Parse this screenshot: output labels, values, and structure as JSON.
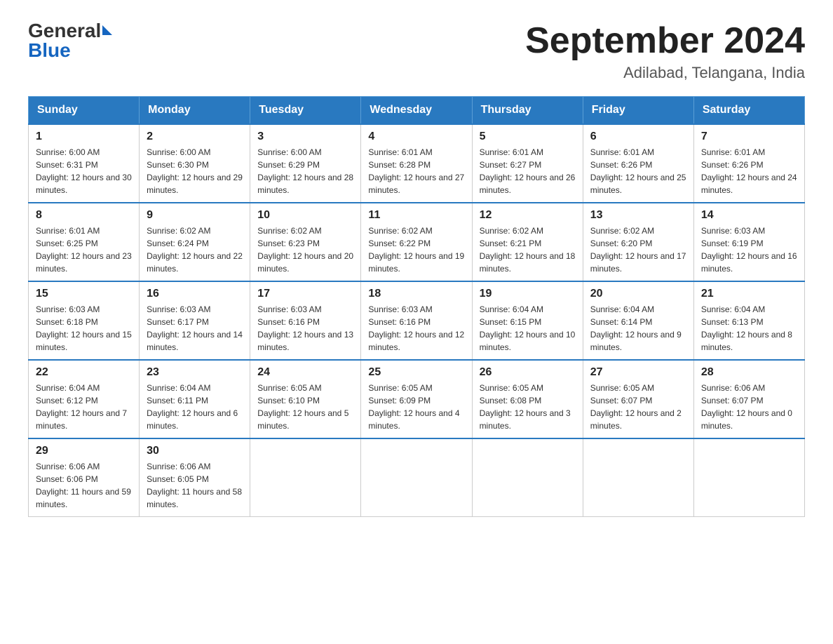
{
  "header": {
    "logo_general": "General",
    "logo_blue": "Blue",
    "title": "September 2024",
    "subtitle": "Adilabad, Telangana, India"
  },
  "days_of_week": [
    "Sunday",
    "Monday",
    "Tuesday",
    "Wednesday",
    "Thursday",
    "Friday",
    "Saturday"
  ],
  "weeks": [
    [
      {
        "date": "1",
        "sunrise": "Sunrise: 6:00 AM",
        "sunset": "Sunset: 6:31 PM",
        "daylight": "Daylight: 12 hours and 30 minutes."
      },
      {
        "date": "2",
        "sunrise": "Sunrise: 6:00 AM",
        "sunset": "Sunset: 6:30 PM",
        "daylight": "Daylight: 12 hours and 29 minutes."
      },
      {
        "date": "3",
        "sunrise": "Sunrise: 6:00 AM",
        "sunset": "Sunset: 6:29 PM",
        "daylight": "Daylight: 12 hours and 28 minutes."
      },
      {
        "date": "4",
        "sunrise": "Sunrise: 6:01 AM",
        "sunset": "Sunset: 6:28 PM",
        "daylight": "Daylight: 12 hours and 27 minutes."
      },
      {
        "date": "5",
        "sunrise": "Sunrise: 6:01 AM",
        "sunset": "Sunset: 6:27 PM",
        "daylight": "Daylight: 12 hours and 26 minutes."
      },
      {
        "date": "6",
        "sunrise": "Sunrise: 6:01 AM",
        "sunset": "Sunset: 6:26 PM",
        "daylight": "Daylight: 12 hours and 25 minutes."
      },
      {
        "date": "7",
        "sunrise": "Sunrise: 6:01 AM",
        "sunset": "Sunset: 6:26 PM",
        "daylight": "Daylight: 12 hours and 24 minutes."
      }
    ],
    [
      {
        "date": "8",
        "sunrise": "Sunrise: 6:01 AM",
        "sunset": "Sunset: 6:25 PM",
        "daylight": "Daylight: 12 hours and 23 minutes."
      },
      {
        "date": "9",
        "sunrise": "Sunrise: 6:02 AM",
        "sunset": "Sunset: 6:24 PM",
        "daylight": "Daylight: 12 hours and 22 minutes."
      },
      {
        "date": "10",
        "sunrise": "Sunrise: 6:02 AM",
        "sunset": "Sunset: 6:23 PM",
        "daylight": "Daylight: 12 hours and 20 minutes."
      },
      {
        "date": "11",
        "sunrise": "Sunrise: 6:02 AM",
        "sunset": "Sunset: 6:22 PM",
        "daylight": "Daylight: 12 hours and 19 minutes."
      },
      {
        "date": "12",
        "sunrise": "Sunrise: 6:02 AM",
        "sunset": "Sunset: 6:21 PM",
        "daylight": "Daylight: 12 hours and 18 minutes."
      },
      {
        "date": "13",
        "sunrise": "Sunrise: 6:02 AM",
        "sunset": "Sunset: 6:20 PM",
        "daylight": "Daylight: 12 hours and 17 minutes."
      },
      {
        "date": "14",
        "sunrise": "Sunrise: 6:03 AM",
        "sunset": "Sunset: 6:19 PM",
        "daylight": "Daylight: 12 hours and 16 minutes."
      }
    ],
    [
      {
        "date": "15",
        "sunrise": "Sunrise: 6:03 AM",
        "sunset": "Sunset: 6:18 PM",
        "daylight": "Daylight: 12 hours and 15 minutes."
      },
      {
        "date": "16",
        "sunrise": "Sunrise: 6:03 AM",
        "sunset": "Sunset: 6:17 PM",
        "daylight": "Daylight: 12 hours and 14 minutes."
      },
      {
        "date": "17",
        "sunrise": "Sunrise: 6:03 AM",
        "sunset": "Sunset: 6:16 PM",
        "daylight": "Daylight: 12 hours and 13 minutes."
      },
      {
        "date": "18",
        "sunrise": "Sunrise: 6:03 AM",
        "sunset": "Sunset: 6:16 PM",
        "daylight": "Daylight: 12 hours and 12 minutes."
      },
      {
        "date": "19",
        "sunrise": "Sunrise: 6:04 AM",
        "sunset": "Sunset: 6:15 PM",
        "daylight": "Daylight: 12 hours and 10 minutes."
      },
      {
        "date": "20",
        "sunrise": "Sunrise: 6:04 AM",
        "sunset": "Sunset: 6:14 PM",
        "daylight": "Daylight: 12 hours and 9 minutes."
      },
      {
        "date": "21",
        "sunrise": "Sunrise: 6:04 AM",
        "sunset": "Sunset: 6:13 PM",
        "daylight": "Daylight: 12 hours and 8 minutes."
      }
    ],
    [
      {
        "date": "22",
        "sunrise": "Sunrise: 6:04 AM",
        "sunset": "Sunset: 6:12 PM",
        "daylight": "Daylight: 12 hours and 7 minutes."
      },
      {
        "date": "23",
        "sunrise": "Sunrise: 6:04 AM",
        "sunset": "Sunset: 6:11 PM",
        "daylight": "Daylight: 12 hours and 6 minutes."
      },
      {
        "date": "24",
        "sunrise": "Sunrise: 6:05 AM",
        "sunset": "Sunset: 6:10 PM",
        "daylight": "Daylight: 12 hours and 5 minutes."
      },
      {
        "date": "25",
        "sunrise": "Sunrise: 6:05 AM",
        "sunset": "Sunset: 6:09 PM",
        "daylight": "Daylight: 12 hours and 4 minutes."
      },
      {
        "date": "26",
        "sunrise": "Sunrise: 6:05 AM",
        "sunset": "Sunset: 6:08 PM",
        "daylight": "Daylight: 12 hours and 3 minutes."
      },
      {
        "date": "27",
        "sunrise": "Sunrise: 6:05 AM",
        "sunset": "Sunset: 6:07 PM",
        "daylight": "Daylight: 12 hours and 2 minutes."
      },
      {
        "date": "28",
        "sunrise": "Sunrise: 6:06 AM",
        "sunset": "Sunset: 6:07 PM",
        "daylight": "Daylight: 12 hours and 0 minutes."
      }
    ],
    [
      {
        "date": "29",
        "sunrise": "Sunrise: 6:06 AM",
        "sunset": "Sunset: 6:06 PM",
        "daylight": "Daylight: 11 hours and 59 minutes."
      },
      {
        "date": "30",
        "sunrise": "Sunrise: 6:06 AM",
        "sunset": "Sunset: 6:05 PM",
        "daylight": "Daylight: 11 hours and 58 minutes."
      },
      null,
      null,
      null,
      null,
      null
    ]
  ]
}
